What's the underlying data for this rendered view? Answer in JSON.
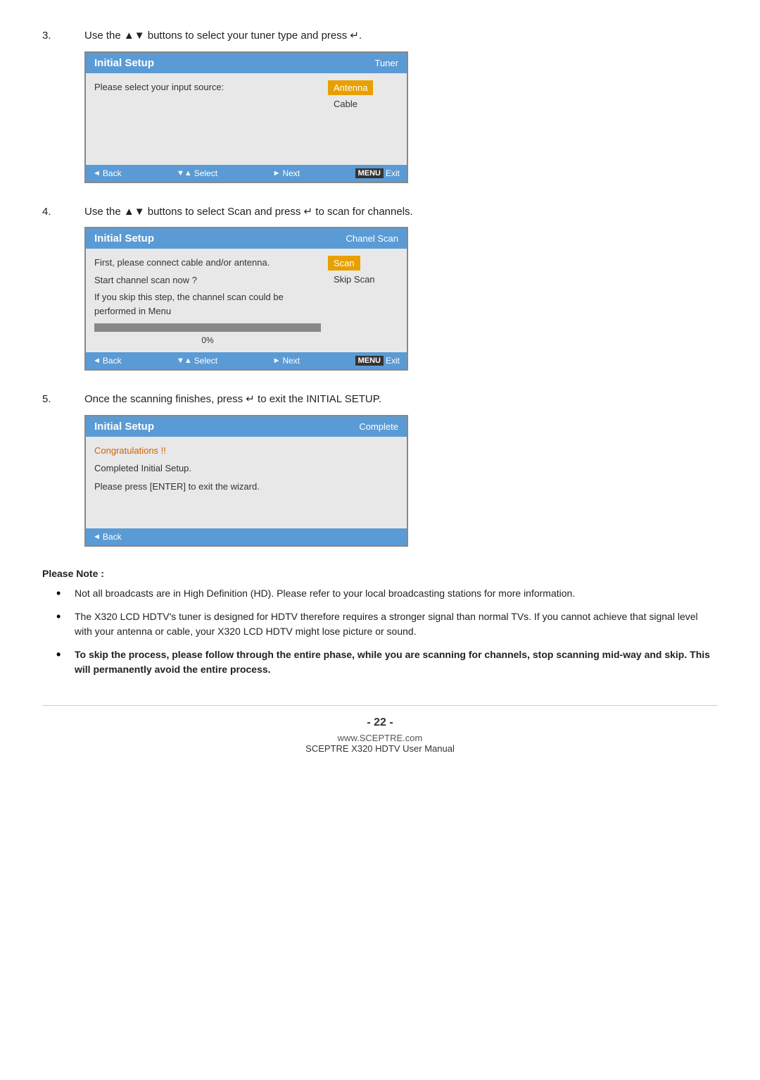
{
  "steps": [
    {
      "number": "3.",
      "instruction_parts": [
        "Use the ",
        "▲▼",
        " buttons to select your tuner type and press ↵."
      ],
      "dialog": {
        "title": "Initial Setup",
        "header_right": "Tuner",
        "body_left_text": "Please select your input source:",
        "options": [
          {
            "label": "Antenna",
            "selected": true
          },
          {
            "label": "Cable",
            "selected": false
          }
        ],
        "footer": {
          "back_label": "Back",
          "select_label": "Select",
          "next_label": "Next",
          "exit_label": "Exit",
          "menu_label": "MENU"
        }
      }
    },
    {
      "number": "4.",
      "instruction_parts": [
        "Use the ",
        "▲▼",
        " buttons to select Scan and press ↵ to scan for channels."
      ],
      "dialog": {
        "title": "Initial Setup",
        "header_right": "Chanel Scan",
        "body_left_lines": [
          "First, please connect cable and/or antenna.",
          "",
          "Start channel scan now ?",
          "",
          "If you skip this step, the channel scan could be performed in Menu"
        ],
        "options": [
          {
            "label": "Scan",
            "selected": true
          },
          {
            "label": "Skip Scan",
            "selected": false
          }
        ],
        "progress": {
          "value": 0,
          "label": "0%"
        },
        "footer": {
          "back_label": "Back",
          "select_label": "Select",
          "next_label": "Next",
          "exit_label": "Exit",
          "menu_label": "MENU"
        }
      }
    },
    {
      "number": "5.",
      "instruction_parts": [
        "Once the scanning finishes, press ↵ to exit the INITIAL SETUP."
      ],
      "dialog": {
        "title": "Initial Setup",
        "header_right": "Complete",
        "body_lines": [
          {
            "text": "Congratulations !!",
            "orange": true
          },
          {
            "text": "",
            "orange": false
          },
          {
            "text": "Completed Initial Setup.",
            "orange": false
          },
          {
            "text": "",
            "orange": false
          },
          {
            "text": "Please press [ENTER] to exit the wizard.",
            "orange": false
          }
        ],
        "footer": {
          "back_label": "Back"
        }
      }
    }
  ],
  "notes": {
    "title": "Please Note :",
    "items": [
      {
        "text": "Not all broadcasts are in High Definition (HD).  Please refer to your local broadcasting stations for more information.",
        "bold": false
      },
      {
        "text": "The X320 LCD HDTV's tuner is designed for HDTV therefore requires a stronger signal than normal TVs.  If you cannot achieve that signal level with your antenna or cable, your X320 LCD HDTV might lose picture or sound.",
        "bold": false
      },
      {
        "text": "To skip the process, please follow through the entire phase, while you are scanning for channels, stop scanning mid-way and skip.  This will permanently avoid the entire process.",
        "bold": true
      }
    ]
  },
  "footer": {
    "page_number": "- 22 -",
    "website": "www.SCEPTRE.com",
    "model": "SCEPTRE X320 HDTV User Manual"
  }
}
